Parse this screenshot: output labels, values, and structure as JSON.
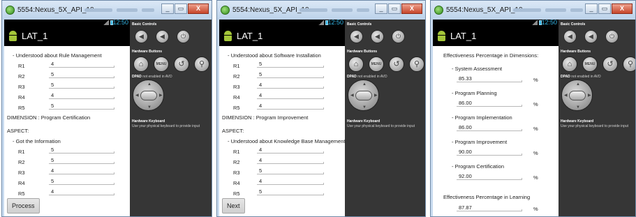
{
  "window": {
    "title": "5554:Nexus_5X_API_10",
    "close_glyph": "X",
    "minimize_glyph": "_",
    "maximize_glyph": "▭"
  },
  "statusbar": {
    "time": "12:50"
  },
  "app": {
    "title": "LAT_1"
  },
  "side_panel": {
    "basic_controls": "Basic Controls",
    "basic_buttons": [
      {
        "icon": "volume-down-icon",
        "glyph": "◀"
      },
      {
        "icon": "volume-up-icon",
        "glyph": "◀"
      },
      {
        "icon": "power-icon",
        "glyph": "⏻"
      }
    ],
    "hardware_buttons": "Hardware Buttons",
    "hw_buttons": [
      {
        "icon": "home-icon",
        "glyph": "⌂"
      },
      {
        "icon": "menu-icon",
        "glyph": "MENU"
      },
      {
        "icon": "back-icon",
        "glyph": "↺"
      },
      {
        "icon": "search-icon",
        "glyph": "⚲"
      }
    ],
    "dpad_label": "DPAD",
    "dpad_note": "not enabled in AVD",
    "keyboard_title": "Hardware Keyboard",
    "keyboard_note": "Use your physical keyboard to provide input"
  },
  "screens": [
    {
      "heading1": "- Understood about Rule Management",
      "group1": [
        {
          "label": "R1",
          "value": "4"
        },
        {
          "label": "R2",
          "value": "5"
        },
        {
          "label": "R3",
          "value": "5"
        },
        {
          "label": "R4",
          "value": "4"
        },
        {
          "label": "R5",
          "value": "5"
        }
      ],
      "dimension": "DIMENSION : Program Certification",
      "aspect": "ASPECT:",
      "heading2": "- Got the Information",
      "group2": [
        {
          "label": "R1",
          "value": "5"
        },
        {
          "label": "R2",
          "value": "5"
        },
        {
          "label": "R3",
          "value": "4"
        },
        {
          "label": "R4",
          "value": "5"
        },
        {
          "label": "R5",
          "value": "4"
        }
      ],
      "button": "Process"
    },
    {
      "heading1": "- Understood about Software Installation",
      "group1": [
        {
          "label": "R1",
          "value": "5"
        },
        {
          "label": "R2",
          "value": "5"
        },
        {
          "label": "R3",
          "value": "4"
        },
        {
          "label": "R4",
          "value": "4"
        },
        {
          "label": "R5",
          "value": "4"
        }
      ],
      "dimension": "DIMENSION : Program Improvement",
      "aspect": "ASPECT:",
      "heading2": "- Understood about Knowledge Base Management",
      "group2": [
        {
          "label": "R1",
          "value": "4"
        },
        {
          "label": "R2",
          "value": "4"
        },
        {
          "label": "R3",
          "value": "5"
        },
        {
          "label": "R4",
          "value": "4"
        },
        {
          "label": "R5",
          "value": "5"
        }
      ],
      "button": "Next"
    },
    {
      "header": "Effectiveness Percentage in Dimensions:",
      "dimensions": [
        {
          "name": "- System Assessment",
          "value": "85.33",
          "unit": "%"
        },
        {
          "name": "- Program Planning",
          "value": "86.00",
          "unit": "%"
        },
        {
          "name": "- Program Implementation",
          "value": "86.00",
          "unit": "%"
        },
        {
          "name": "- Program Improvement",
          "value": "90.00",
          "unit": "%"
        },
        {
          "name": "- Program Certification",
          "value": "92.00",
          "unit": "%"
        }
      ],
      "learning_label": "Effectiveness Percentage in Learning",
      "learning_value": "87.87",
      "learning_unit": "%"
    }
  ]
}
